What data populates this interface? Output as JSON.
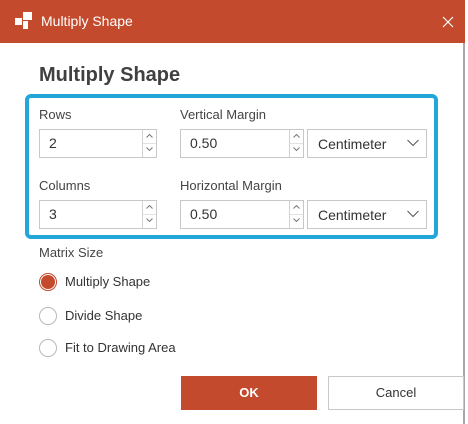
{
  "window": {
    "title": "Multiply Shape",
    "icon": "shape-app-icon",
    "close_icon": "close-icon"
  },
  "dialog": {
    "heading": "Multiply Shape"
  },
  "fields": {
    "rows": {
      "label": "Rows",
      "value": "2"
    },
    "columns": {
      "label": "Columns",
      "value": "3"
    },
    "vertical_margin": {
      "label": "Vertical Margin",
      "value": "0.50",
      "unit": "Centimeter"
    },
    "horizontal_margin": {
      "label": "Horizontal Margin",
      "value": "0.50",
      "unit": "Centimeter"
    }
  },
  "matrix_size": {
    "label": "Matrix Size",
    "options": [
      {
        "label": "Multiply Shape",
        "checked": true
      },
      {
        "label": "Divide Shape",
        "checked": false
      },
      {
        "label": "Fit to Drawing Area",
        "checked": false
      }
    ]
  },
  "buttons": {
    "ok": "OK",
    "cancel": "Cancel"
  },
  "colors": {
    "accent": "#c34a2c",
    "highlight": "#22a7d8"
  }
}
